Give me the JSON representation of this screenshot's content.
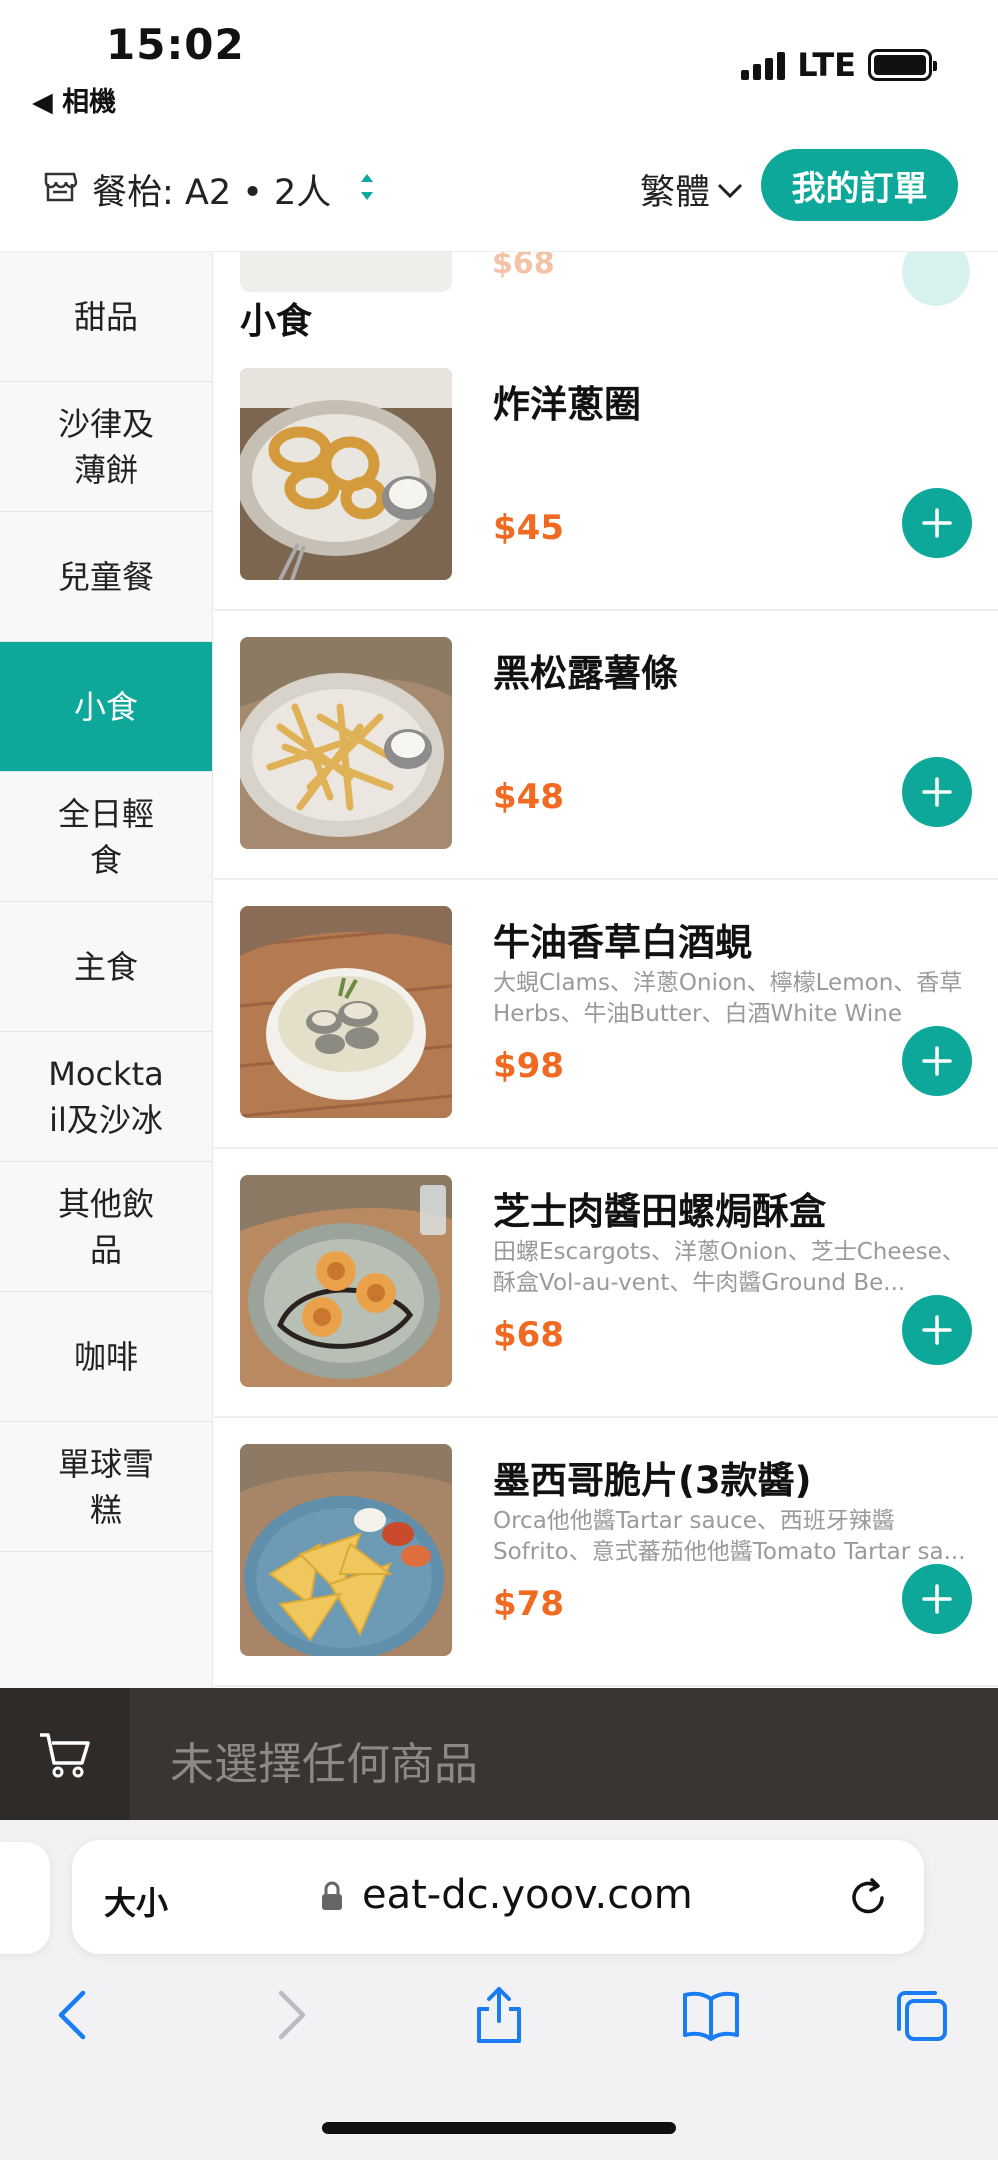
{
  "status": {
    "time": "15:02",
    "back_label": "◀ 相機",
    "network": "LTE",
    "battery_level": 1.0
  },
  "header": {
    "table_label": "餐枱:  A2 • 2人",
    "language": "繁體",
    "orders_button": "我的訂單",
    "store_icon": "store-icon",
    "sort_icon": "sort-icon"
  },
  "sidebar": {
    "categories": [
      {
        "label": "甜品"
      },
      {
        "label": "沙律及\n薄餅"
      },
      {
        "label": "兒童餐"
      },
      {
        "label": "小食"
      },
      {
        "label": "全日輕\n食"
      },
      {
        "label": "主食"
      },
      {
        "label": "Mockta\nil及沙冰"
      },
      {
        "label": "其他飲\n品"
      },
      {
        "label": "咖啡"
      },
      {
        "label": "單球雪\n糕"
      }
    ],
    "active_index": 3
  },
  "content": {
    "ghost_price": "$68",
    "section_title": "小食",
    "items": [
      {
        "name": "炸洋蔥圈",
        "desc": "",
        "price": "$45",
        "image": "onion-rings"
      },
      {
        "name": "黑松露薯條",
        "desc": "",
        "price": "$48",
        "image": "truffle-fries"
      },
      {
        "name": "牛油香草白酒蜆",
        "desc": "大蜆Clams、洋蔥Onion、檸檬Lemon、香草Herbs、牛油Butter、白酒White Wine",
        "price": "$98",
        "image": "clams-bowl"
      },
      {
        "name": "芝士肉醬田螺焗酥盒",
        "desc": "田螺Escargots、洋蔥Onion、芝士Cheese、酥盒Vol-au-vent、牛肉醬Ground Be...",
        "price": "$68",
        "image": "escargot-vol-au-vent"
      },
      {
        "name": "墨西哥脆片(3款醬)",
        "desc": "Orca他他醬Tartar sauce、西班牙辣醬Sofrito、意式蕃茄他他醬Tomato Tartar sa...",
        "price": "$78",
        "image": "nachos-plate"
      }
    ]
  },
  "cart": {
    "empty_text": "未選擇任何商品",
    "icon": "cart-icon"
  },
  "browser": {
    "text_size_label": "大小",
    "url": "eat-dc.yoov.com",
    "icons": [
      "lock-icon",
      "reload-icon",
      "back-icon",
      "forward-icon",
      "share-icon",
      "bookmarks-icon",
      "tabs-icon"
    ]
  },
  "colors": {
    "accent": "#0ea89a",
    "price": "#f06a22",
    "cart_bar": "#3a3532"
  }
}
